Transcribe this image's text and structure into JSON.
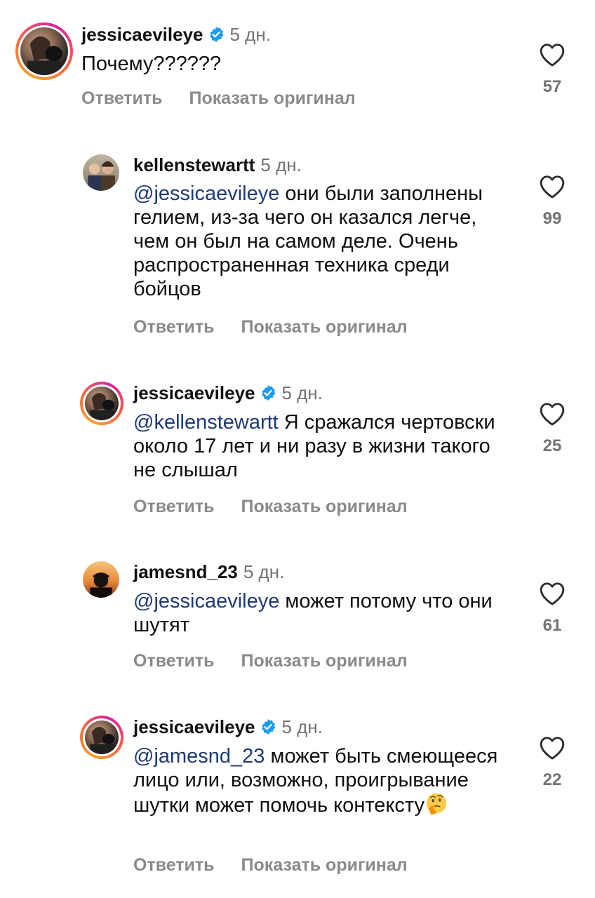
{
  "comments": [
    {
      "username": "jessicaevileye",
      "verified": true,
      "time": "5 дн.",
      "mention": "",
      "text": "Почему??????",
      "reply_label": "Ответить",
      "translate_label": "Показать оригинал",
      "likes": "57"
    },
    {
      "username": "kellenstewartt",
      "verified": false,
      "time": "5 дн.",
      "mention": "@jessicaevileye",
      "text": " они были заполнены гелием, из-за чего он казался легче, чем он был на самом деле. Очень распространенная техника среди бойцов",
      "reply_label": "Ответить",
      "translate_label": "Показать оригинал",
      "likes": "99"
    },
    {
      "username": "jessicaevileye",
      "verified": true,
      "time": "5 дн.",
      "mention": "@kellenstewartt",
      "text": " Я сражался чертовски около 17 лет и ни разу в жизни такого не слышал",
      "reply_label": "Ответить",
      "translate_label": "Показать оригинал",
      "likes": "25"
    },
    {
      "username": "jamesnd_23",
      "verified": false,
      "time": "5 дн.",
      "mention": "@jessicaevileye",
      "text": " может потому что они шутят",
      "reply_label": "Ответить",
      "translate_label": "Показать оригинал",
      "likes": "61"
    },
    {
      "username": "jessicaevileye",
      "verified": true,
      "time": "5 дн.",
      "mention": "@jamesnd_23",
      "text": " может быть смеющееся лицо или, возможно, проигрывание шутки может помочь контексту",
      "emoji": "thinking-face-emoji",
      "reply_label": "Ответить",
      "translate_label": "Показать оригинал",
      "likes": "22"
    }
  ],
  "colors": {
    "mention": "#1e3a78",
    "verified": "#1d9bf0",
    "secondary_text": "#737373"
  },
  "icons": {
    "like": "heart-outline-icon",
    "verified": "verified-badge-icon"
  }
}
